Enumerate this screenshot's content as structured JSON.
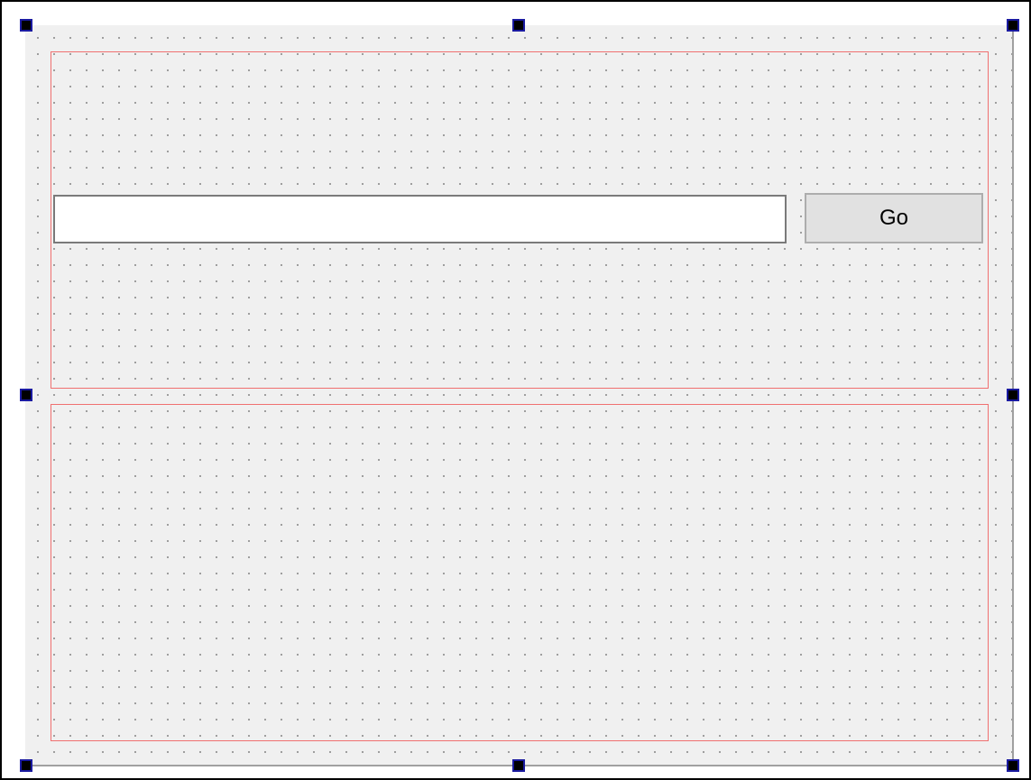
{
  "form": {
    "line_edit": {
      "value": "",
      "placeholder": ""
    },
    "go_button": {
      "label": "Go"
    }
  },
  "colors": {
    "canvas_background": "#f0f0f0",
    "layout_border": "#f07070",
    "selection_handle": "#000000"
  }
}
